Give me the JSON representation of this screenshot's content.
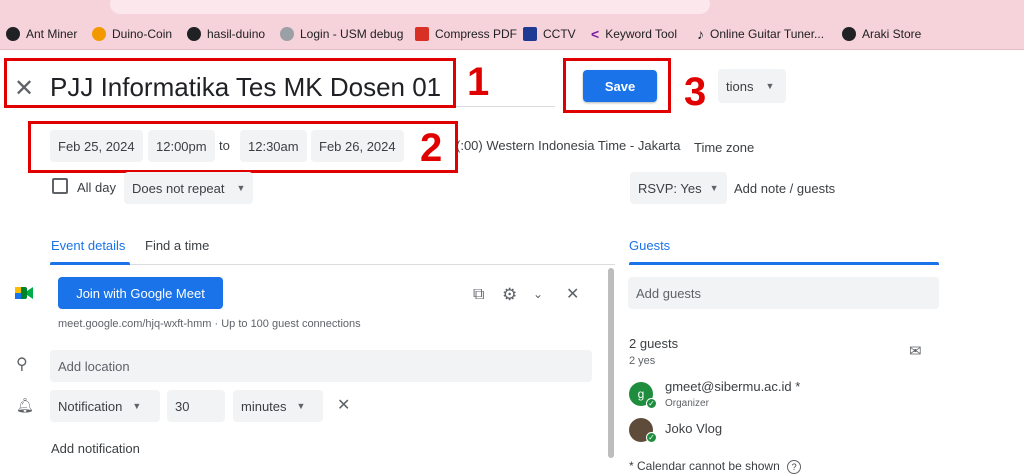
{
  "bookmarks": [
    {
      "label": "Ant Miner",
      "icon": "github-icon"
    },
    {
      "label": "Duino-Coin",
      "icon": "coin-icon"
    },
    {
      "label": "hasil-duino",
      "icon": "github-icon"
    },
    {
      "label": "Login - USM debug",
      "icon": "globe-icon"
    },
    {
      "label": "Compress PDF",
      "icon": "pdf-icon"
    },
    {
      "label": "CCTV",
      "icon": "camera-icon"
    },
    {
      "label": "Keyword Tool",
      "icon": "keyword-icon"
    },
    {
      "label": "Online Guitar Tuner...",
      "icon": "tuner-icon"
    },
    {
      "label": "Araki Store",
      "icon": "github-icon"
    }
  ],
  "event": {
    "title": "PJJ Informatika Tes MK Dosen 01",
    "save_label": "Save",
    "options_label": "tions",
    "start_date": "Feb 25, 2024",
    "start_time": "12:00pm",
    "to_label": "to",
    "end_time": "12:30am",
    "end_date": "Feb 26, 2024",
    "timezone_text": "(:00) Western Indonesia Time - Jakarta",
    "timezone_link": "Time zone",
    "all_day_label": "All day",
    "repeat_label": "Does not repeat",
    "rsvp_label": "RSVP: Yes",
    "add_note_label": "Add note / guests"
  },
  "annotations": [
    "1",
    "2",
    "3"
  ],
  "tabs": {
    "event_details": "Event details",
    "find_time": "Find a time"
  },
  "meet": {
    "button_label": "Join with Google Meet",
    "link_text": "meet.google.com/hjq-wxft-hmm · Up to 100 guest connections"
  },
  "location": {
    "placeholder": "Add location"
  },
  "notification": {
    "type": "Notification",
    "amount": "30",
    "unit": "minutes",
    "add_label": "Add notification"
  },
  "guests": {
    "title": "Guests",
    "add_placeholder": "Add guests",
    "count_label": "2 guests",
    "yes_label": "2 yes",
    "list": [
      {
        "name": "gmeet@sibermu.ac.id *",
        "role": "Organizer",
        "initial": "g"
      },
      {
        "name": "Joko Vlog",
        "role": "",
        "initial": ""
      }
    ],
    "calendar_note": "* Calendar cannot be shown"
  },
  "colors": {
    "accent": "#1a73e8",
    "annotation": "#e00000",
    "bookmark_bar": "#f6d2da"
  }
}
